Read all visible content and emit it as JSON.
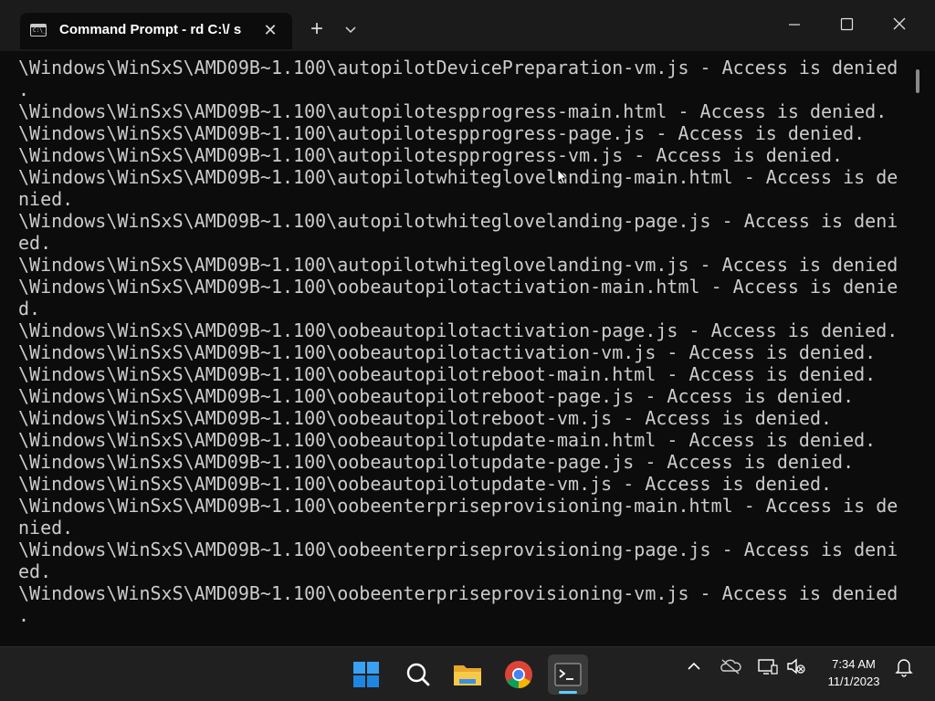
{
  "window": {
    "tab_title": "Command Prompt - rd  C:\\/ s",
    "tab_icon_glyph": "C:\\_"
  },
  "console": {
    "lines": [
      "\\Windows\\WinSxS\\AMD09B~1.100\\autopilotDevicePreparation-vm.js - Access is denied",
      ".",
      "\\Windows\\WinSxS\\AMD09B~1.100\\autopilotespprogress-main.html - Access is denied.",
      "\\Windows\\WinSxS\\AMD09B~1.100\\autopilotespprogress-page.js - Access is denied.",
      "\\Windows\\WinSxS\\AMD09B~1.100\\autopilotespprogress-vm.js - Access is denied.",
      "\\Windows\\WinSxS\\AMD09B~1.100\\autopilotwhiteglovelanding-main.html - Access is de",
      "nied.",
      "\\Windows\\WinSxS\\AMD09B~1.100\\autopilotwhiteglovelanding-page.js - Access is deni",
      "ed.",
      "\\Windows\\WinSxS\\AMD09B~1.100\\autopilotwhiteglovelanding-vm.js - Access is denied",
      "\\Windows\\WinSxS\\AMD09B~1.100\\oobeautopilotactivation-main.html - Access is denie",
      "d.",
      "\\Windows\\WinSxS\\AMD09B~1.100\\oobeautopilotactivation-page.js - Access is denied.",
      "\\Windows\\WinSxS\\AMD09B~1.100\\oobeautopilotactivation-vm.js - Access is denied.",
      "\\Windows\\WinSxS\\AMD09B~1.100\\oobeautopilotreboot-main.html - Access is denied.",
      "\\Windows\\WinSxS\\AMD09B~1.100\\oobeautopilotreboot-page.js - Access is denied.",
      "\\Windows\\WinSxS\\AMD09B~1.100\\oobeautopilotreboot-vm.js - Access is denied.",
      "\\Windows\\WinSxS\\AMD09B~1.100\\oobeautopilotupdate-main.html - Access is denied.",
      "\\Windows\\WinSxS\\AMD09B~1.100\\oobeautopilotupdate-page.js - Access is denied.",
      "\\Windows\\WinSxS\\AMD09B~1.100\\oobeautopilotupdate-vm.js - Access is denied.",
      "\\Windows\\WinSxS\\AMD09B~1.100\\oobeenterpriseprovisioning-main.html - Access is de",
      "nied.",
      "\\Windows\\WinSxS\\AMD09B~1.100\\oobeenterpriseprovisioning-page.js - Access is deni",
      "ed.",
      "\\Windows\\WinSxS\\AMD09B~1.100\\oobeenterpriseprovisioning-vm.js - Access is denied",
      "."
    ],
    "text_color": "#cccccc",
    "background": "#0c0c0c"
  },
  "taskbar": {
    "apps": [
      {
        "name": "start-icon"
      },
      {
        "name": "search-icon"
      },
      {
        "name": "file-explorer-icon"
      },
      {
        "name": "chrome-icon"
      },
      {
        "name": "terminal-icon",
        "active": true
      }
    ],
    "tray": [
      "chevron-up-icon",
      "onedrive-offline-icon",
      "network-icon",
      "volume-muted-icon",
      "notifications-icon"
    ],
    "clock": {
      "time": "7:34 AM",
      "date": "11/1/2023"
    },
    "accent": "#60cdff"
  }
}
